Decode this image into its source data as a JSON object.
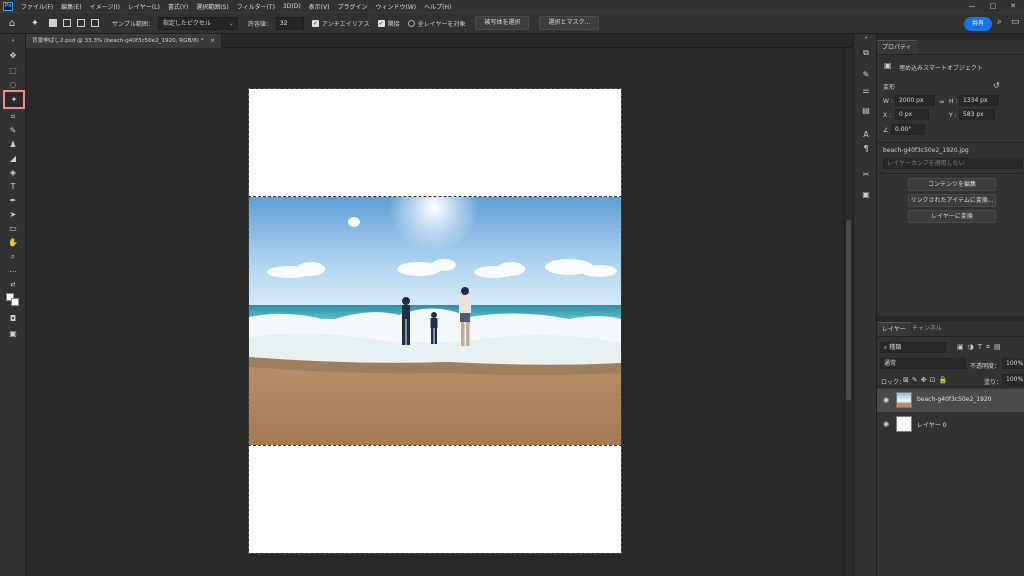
{
  "app": {
    "logo": "Ps"
  },
  "menubar": {
    "items": [
      "ファイル(F)",
      "編集(E)",
      "イメージ(I)",
      "レイヤー(L)",
      "書式(Y)",
      "選択範囲(S)",
      "フィルター(T)",
      "3D(D)",
      "表示(V)",
      "プラグイン",
      "ウィンドウ(W)",
      "ヘルプ(H)"
    ],
    "window_buttons": [
      "—",
      "□",
      "✕"
    ]
  },
  "options": {
    "sample_label": "サンプル範囲：",
    "sample_value": "指定したピクセル",
    "tolerance_label": "許容値：",
    "tolerance_value": "32",
    "antialias_label": "アンチエイリアス",
    "contiguous_label": "隣接",
    "all_layers_label": "全レイヤーを対象",
    "select_subject_label": "被写体を選択",
    "select_mask_label": "選択とマスク...",
    "share_label": "共有"
  },
  "document": {
    "tab_title": "背景伸ばし2.psd @ 33.3% (beach-g40f3c50e2_1920, RGB/8) *",
    "close_symbol": "×"
  },
  "properties": {
    "tabs": [
      "プロパティ"
    ],
    "layer_type": "埋め込みスマートオブジェクト",
    "transform_label": "変形",
    "w_label": "W :",
    "w_value": "2000 px",
    "h_label": "H :",
    "h_value": "1334 px",
    "x_label": "X :",
    "x_value": "0 px",
    "y_label": "Y :",
    "y_value": "583 px",
    "angle_value": "0.00°",
    "file_name": "beach-g40f3c50e2_1920.jpg",
    "layer_comp_placeholder": "レイヤーカンプを適用しない",
    "btn_edit_contents": "コンテンツを編集",
    "btn_convert_linked": "リンクされたアイテムに変換...",
    "btn_convert_layers": "レイヤーに変換"
  },
  "layers": {
    "tabs": [
      "レイヤー",
      "チャンネル"
    ],
    "filter_kind": "種類",
    "blend_mode": "通常",
    "opacity_label": "不透明度：",
    "opacity_value": "100%",
    "lock_label": "ロック：",
    "fill_label": "塗り：",
    "fill_value": "100%",
    "rows": [
      {
        "name": "beach-g40f3c50e2_1920",
        "selected": true
      },
      {
        "name": "レイヤー 0",
        "selected": false
      }
    ]
  },
  "colors": {
    "accent": "#1473e6",
    "highlight": "#f28b8b",
    "app_bg": "#282828",
    "panel_bg": "#323232"
  }
}
